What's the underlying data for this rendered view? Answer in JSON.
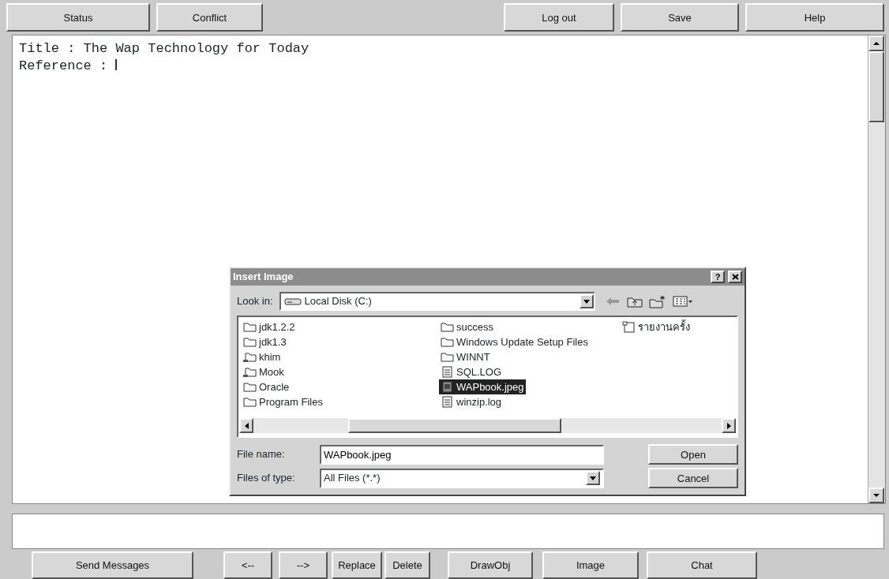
{
  "top_buttons": [
    {
      "label": "Status"
    },
    {
      "label": "Conflict"
    },
    {
      "label": "Log out"
    },
    {
      "label": "Save"
    },
    {
      "label": "Help"
    }
  ],
  "editor": {
    "lines": [
      "Title : The Wap Technology for Today",
      "Reference : "
    ]
  },
  "dialog": {
    "title": "Insert Image",
    "help_button": "?",
    "look_in": {
      "label": "Look in:",
      "value": "Local Disk (C:)"
    },
    "files": [
      {
        "name": "jdk1.2.2",
        "kind": "folder",
        "selected": false
      },
      {
        "name": "jdk1.3",
        "kind": "folder",
        "selected": false
      },
      {
        "name": "khim",
        "kind": "shared-folder",
        "selected": false
      },
      {
        "name": "Mook",
        "kind": "shared-folder",
        "selected": false
      },
      {
        "name": "Oracle",
        "kind": "folder",
        "selected": false
      },
      {
        "name": "Program Files",
        "kind": "folder",
        "selected": false
      },
      {
        "name": "success",
        "kind": "folder",
        "selected": false
      },
      {
        "name": "Windows Update Setup Files",
        "kind": "folder",
        "selected": false
      },
      {
        "name": "WINNT",
        "kind": "folder",
        "selected": false
      },
      {
        "name": "SQL.LOG",
        "kind": "text",
        "selected": false
      },
      {
        "name": "WAPbook.jpeg",
        "kind": "image",
        "selected": true
      },
      {
        "name": "winzip.log",
        "kind": "text",
        "selected": false
      },
      {
        "name": "รายงานครั้ง",
        "kind": "document",
        "selected": false
      }
    ],
    "file_name": {
      "label": "File name:",
      "value": "WAPbook.jpeg"
    },
    "file_type": {
      "label": "Files of type:",
      "value": "All Files (*.*)"
    },
    "buttons": [
      "Open",
      "Cancel"
    ]
  },
  "bottom_buttons": [
    {
      "label": "Send Messages"
    },
    {
      "label": "<--"
    },
    {
      "label": "-->"
    },
    {
      "label": "Replace"
    },
    {
      "label": "Delete"
    },
    {
      "label": "DrawObj"
    },
    {
      "label": "Image"
    },
    {
      "label": "Chat"
    }
  ]
}
